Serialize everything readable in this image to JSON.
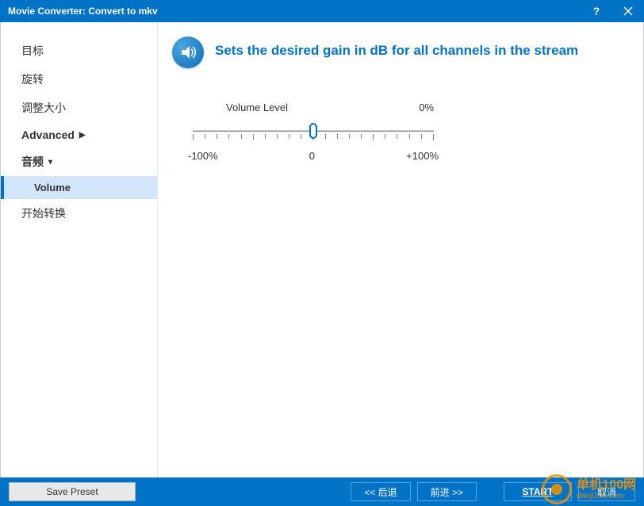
{
  "titlebar": {
    "title": "Movie Converter:  Convert to mkv"
  },
  "sidebar": {
    "items": [
      {
        "label": "目标",
        "expandable": false
      },
      {
        "label": "旋转",
        "expandable": false
      },
      {
        "label": "调整大小",
        "expandable": false
      },
      {
        "label": "Advanced",
        "expandable": true,
        "expanded": false
      },
      {
        "label": "音频",
        "expandable": true,
        "expanded": true
      },
      {
        "label": "开始转换",
        "expandable": false
      }
    ],
    "sub_volume": "Volume"
  },
  "content": {
    "description": "Sets the desired gain in dB for all channels in the stream",
    "slider": {
      "name_label": "Volume Level",
      "value_label": "0%",
      "min_label": "-100%",
      "center_label": "0",
      "max_label": "+100%",
      "value": 0,
      "min": -100,
      "max": 100
    }
  },
  "footer": {
    "save_preset": "Save Preset",
    "back": "<<  后退",
    "forward": "前进  >>",
    "cancel": "取消",
    "start": "START"
  },
  "watermark": {
    "line1": "单机100网",
    "line2": "danji100.com"
  }
}
